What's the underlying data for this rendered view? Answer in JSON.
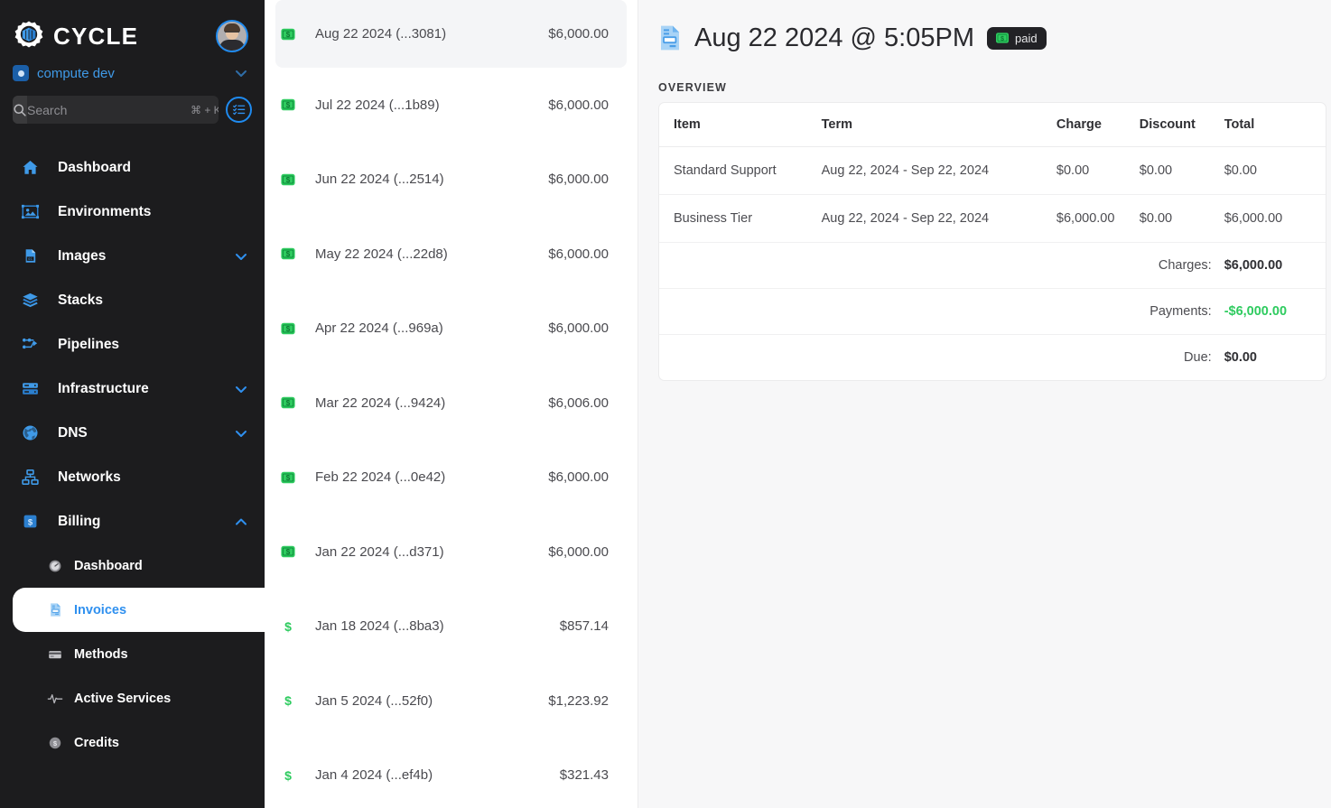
{
  "sidebar": {
    "brand": "CYCLE",
    "brand_icon": "cycle-gear-cube-logo",
    "avatar_icon": "user-avatar",
    "context": {
      "label": "compute dev",
      "icon": "hub-icon",
      "chevron": "chevron-down-icon"
    },
    "search": {
      "placeholder": "Search",
      "value": "",
      "shortcut": "⌘ + K",
      "icon": "search-icon"
    },
    "list_button_icon": "list-checklist-icon",
    "nav": [
      {
        "label": "Dashboard",
        "icon": "home-icon",
        "expandable": false
      },
      {
        "label": "Environments",
        "icon": "environments-icon",
        "expandable": false
      },
      {
        "label": "Images",
        "icon": "image-file-icon",
        "expandable": true,
        "expanded": false
      },
      {
        "label": "Stacks",
        "icon": "layers-icon",
        "expandable": false
      },
      {
        "label": "Pipelines",
        "icon": "pipeline-icon",
        "expandable": false
      },
      {
        "label": "Infrastructure",
        "icon": "server-icon",
        "expandable": true,
        "expanded": false
      },
      {
        "label": "DNS",
        "icon": "globe-icon",
        "expandable": true,
        "expanded": false
      },
      {
        "label": "Networks",
        "icon": "network-icon",
        "expandable": false
      },
      {
        "label": "Billing",
        "icon": "dollar-square-icon",
        "expandable": true,
        "expanded": true
      }
    ],
    "billing_sub": [
      {
        "label": "Dashboard",
        "icon": "gauge-icon",
        "selected": false
      },
      {
        "label": "Invoices",
        "icon": "invoice-doc-icon",
        "selected": true
      },
      {
        "label": "Methods",
        "icon": "credit-card-icon",
        "selected": false
      },
      {
        "label": "Active Services",
        "icon": "pulse-icon",
        "selected": false
      },
      {
        "label": "Credits",
        "icon": "coin-icon",
        "selected": false
      }
    ]
  },
  "invoice_list": {
    "items": [
      {
        "name": "Aug 22 2024 (...3081)",
        "amount": "$6,000.00",
        "status_icon": "paid-money-icon",
        "selected": true
      },
      {
        "name": "Jul 22 2024 (...1b89)",
        "amount": "$6,000.00",
        "status_icon": "paid-money-icon",
        "selected": false
      },
      {
        "name": "Jun 22 2024 (...2514)",
        "amount": "$6,000.00",
        "status_icon": "paid-money-icon",
        "selected": false
      },
      {
        "name": "May 22 2024 (...22d8)",
        "amount": "$6,000.00",
        "status_icon": "paid-money-icon",
        "selected": false
      },
      {
        "name": "Apr 22 2024 (...969a)",
        "amount": "$6,000.00",
        "status_icon": "paid-money-icon",
        "selected": false
      },
      {
        "name": "Mar 22 2024 (...9424)",
        "amount": "$6,006.00",
        "status_icon": "paid-money-icon",
        "selected": false
      },
      {
        "name": "Feb 22 2024 (...0e42)",
        "amount": "$6,000.00",
        "status_icon": "paid-money-icon",
        "selected": false
      },
      {
        "name": "Jan 22 2024 (...d371)",
        "amount": "$6,000.00",
        "status_icon": "paid-money-icon",
        "selected": false
      },
      {
        "name": "Jan 18 2024 (...8ba3)",
        "amount": "$857.14",
        "status_icon": "dollar-sign-icon",
        "selected": false
      },
      {
        "name": "Jan 5 2024 (...52f0)",
        "amount": "$1,223.92",
        "status_icon": "dollar-sign-icon",
        "selected": false
      },
      {
        "name": "Jan 4 2024 (...ef4b)",
        "amount": "$321.43",
        "status_icon": "dollar-sign-icon",
        "selected": false
      }
    ]
  },
  "main": {
    "title": "Aug 22 2024 @ 5:05PM",
    "title_icon": "invoice-doc-icon",
    "status_badge": {
      "label": "paid",
      "icon": "paid-money-icon"
    },
    "section_label": "OVERVIEW",
    "table": {
      "columns": [
        "Item",
        "Term",
        "Charge",
        "Discount",
        "Total"
      ],
      "rows": [
        {
          "item": "Standard Support",
          "term": "Aug 22, 2024 - Sep 22, 2024",
          "charge": "$0.00",
          "discount": "$0.00",
          "total": "$0.00"
        },
        {
          "item": "Business Tier",
          "term": "Aug 22, 2024 - Sep 22, 2024",
          "charge": "$6,000.00",
          "discount": "$0.00",
          "total": "$6,000.00"
        }
      ],
      "summary": [
        {
          "label": "Charges:",
          "value": "$6,000.00",
          "color": "#2f2f33"
        },
        {
          "label": "Payments:",
          "value": "-$6,000.00",
          "color": "#2ecb5f"
        },
        {
          "label": "Due:",
          "value": "$0.00",
          "color": "#2f2f33"
        }
      ]
    }
  },
  "colors": {
    "sidebar_bg": "#1c1c1e",
    "accent_blue": "#2f90ef",
    "paid_green": "#2ecb5f",
    "page_bg": "#f7f7f8"
  }
}
